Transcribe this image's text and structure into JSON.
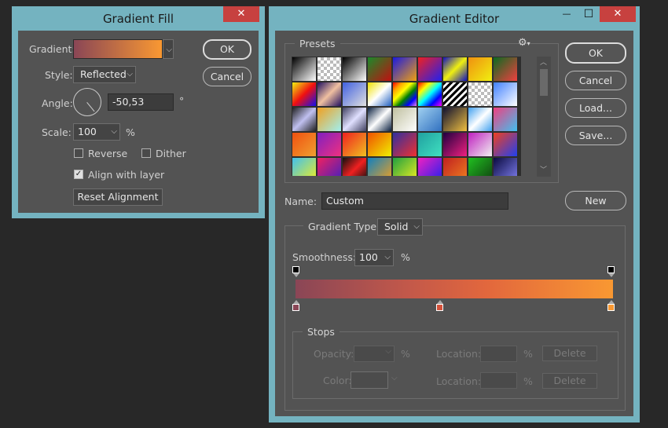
{
  "fill_dialog": {
    "title": "Gradient Fill",
    "close": "✕",
    "gradient_label": "Gradient:",
    "style_label": "Style:",
    "style_value": "Reflected",
    "angle_label": "Angle:",
    "angle_value": "-50,53",
    "degree": "°",
    "scale_label": "Scale:",
    "scale_value": "100",
    "percent": "%",
    "reverse_label": "Reverse",
    "reverse_checked": false,
    "dither_label": "Dither",
    "dither_checked": false,
    "align_label": "Align with layer",
    "align_checked": true,
    "reset_label": "Reset Alignment",
    "ok_label": "OK",
    "cancel_label": "Cancel",
    "gradient_start_color": "#8a4656",
    "gradient_end_color": "#f99832"
  },
  "editor_dialog": {
    "title": "Gradient Editor",
    "minimize": "—",
    "maximize": "☐",
    "close": "✕",
    "presets_label": "Presets",
    "ok_label": "OK",
    "cancel_label": "Cancel",
    "load_label": "Load...",
    "save_label": "Save...",
    "name_label": "Name:",
    "name_value": "Custom",
    "new_label": "New",
    "type_label": "Gradient Type:",
    "type_value": "Solid",
    "smoothness_label": "Smoothness:",
    "smoothness_value": "100",
    "percent": "%",
    "stops_label": "Stops",
    "opacity_label": "Opacity:",
    "color_label": "Color:",
    "location_label": "Location:",
    "delete_label": "Delete",
    "color_stops": [
      "#8a4656",
      "#d4513a",
      "#f99832"
    ],
    "gradient_css": "linear-gradient(to right, #8a4656 0%, #c2584a 35%, #e2673d 60%, #f99832 100%)"
  },
  "presets": [
    "linear-gradient(135deg,#000,#fff)",
    "checker",
    "linear-gradient(135deg,#000,#fff)",
    "linear-gradient(135deg,#1a8a2a,#c01010)",
    "linear-gradient(135deg,#1a1ae0,#f0a010)",
    "linear-gradient(135deg,#f02020,#2020f0)",
    "linear-gradient(135deg,#1010c0,#f0f010,#1010c0)",
    "linear-gradient(135deg,#f09010,#f0f010)",
    "linear-gradient(135deg,#0a6a20,#f04040)",
    "linear-gradient(135deg,#f0f010,#f01010,#1010f0)",
    "linear-gradient(135deg,#201060,#f0c0a0,#201060)",
    "linear-gradient(135deg,#4060e0,#e0e0e0)",
    "linear-gradient(135deg,#f0e000,#fff,#2060c0)",
    "linear-gradient(135deg,red,orange,yellow,green,blue,violet)",
    "linear-gradient(135deg,red,yellow,cyan,blue,magenta)",
    "stripes",
    "checker",
    "linear-gradient(135deg,#4080ff,#ffffff)",
    "linear-gradient(135deg,#202020,#c0c0f0,#202020)",
    "linear-gradient(135deg,#f0a020,#a0f0f0)",
    "linear-gradient(135deg,#404060,#e0e0ff,#404060)",
    "linear-gradient(135deg,#0a2040,#ffffff,#0a2040)",
    "linear-gradient(135deg,#c0c0a0,#ffffff)",
    "linear-gradient(135deg,#a0d0f0,#3070c0)",
    "linear-gradient(135deg,#101030,#f0c040)",
    "linear-gradient(135deg,#40a0f0,#ffffff,#40a0f0)",
    "linear-gradient(135deg,#f04080,#40c0f0)",
    "linear-gradient(135deg,#f05010,#f0a030)",
    "linear-gradient(135deg,#8020c0,#f03080)",
    "linear-gradient(135deg,#f02020,#f0c020)",
    "linear-gradient(135deg,#f05000,#f0f000)",
    "linear-gradient(135deg,#3030a0,#f03030)",
    "linear-gradient(135deg,#20a0a0,#40e0c0)",
    "linear-gradient(135deg,#200040,#f02080)",
    "linear-gradient(135deg,#c020c0,#f0f0f0)",
    "linear-gradient(135deg,#f04020,#2040f0)",
    "linear-gradient(135deg,#40c0f0,#f0f020)",
    "linear-gradient(135deg,#f02060,#4020c0)",
    "linear-gradient(135deg,#101010,#f02020,#101010)",
    "linear-gradient(135deg,#1080c0,#f0a020)",
    "linear-gradient(135deg,#20a040,#f0f020)",
    "linear-gradient(135deg,#f020c0,#2020f0)",
    "linear-gradient(135deg,#c02020,#f08020)",
    "linear-gradient(135deg,#20c020,#104010)",
    "linear-gradient(135deg,#0a0a40,#8080f0)"
  ]
}
